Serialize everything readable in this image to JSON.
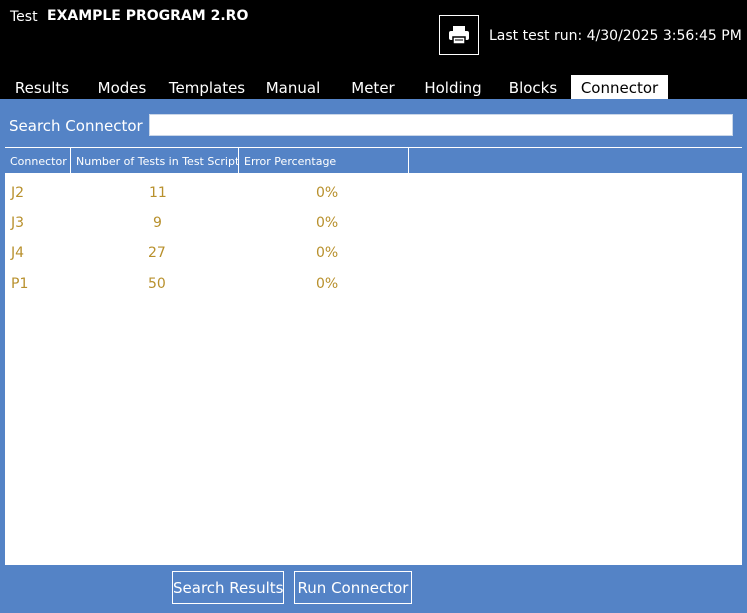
{
  "header": {
    "prefix": "Test",
    "program_name": "EXAMPLE PROGRAM 2.RO",
    "print_icon": "printer-icon",
    "last_run_label": "Last test run:",
    "last_run_value": "4/30/2025 3:56:45 PM"
  },
  "tabs": [
    {
      "label": "Results"
    },
    {
      "label": "Modes"
    },
    {
      "label": "Templates"
    },
    {
      "label": "Manual"
    },
    {
      "label": "Meter"
    },
    {
      "label": "Holding"
    },
    {
      "label": "Blocks"
    },
    {
      "label": "Connector",
      "active": true
    }
  ],
  "search": {
    "label": "Search Connector",
    "value": "",
    "placeholder": ""
  },
  "table": {
    "columns": [
      "Connector",
      "Number of Tests in Test Script",
      "Error Percentage"
    ],
    "rows": [
      {
        "connector": "J2",
        "tests": "11",
        "error": "0%"
      },
      {
        "connector": "J3",
        "tests": "9",
        "error": "0%"
      },
      {
        "connector": "J4",
        "tests": "27",
        "error": "0%"
      },
      {
        "connector": "P1",
        "tests": "50",
        "error": "0%"
      }
    ]
  },
  "buttons": {
    "search_results": "Search Results",
    "run_connector": "Run Connector"
  },
  "colors": {
    "accent": "#5483c6",
    "row_text": "#b8902c"
  }
}
